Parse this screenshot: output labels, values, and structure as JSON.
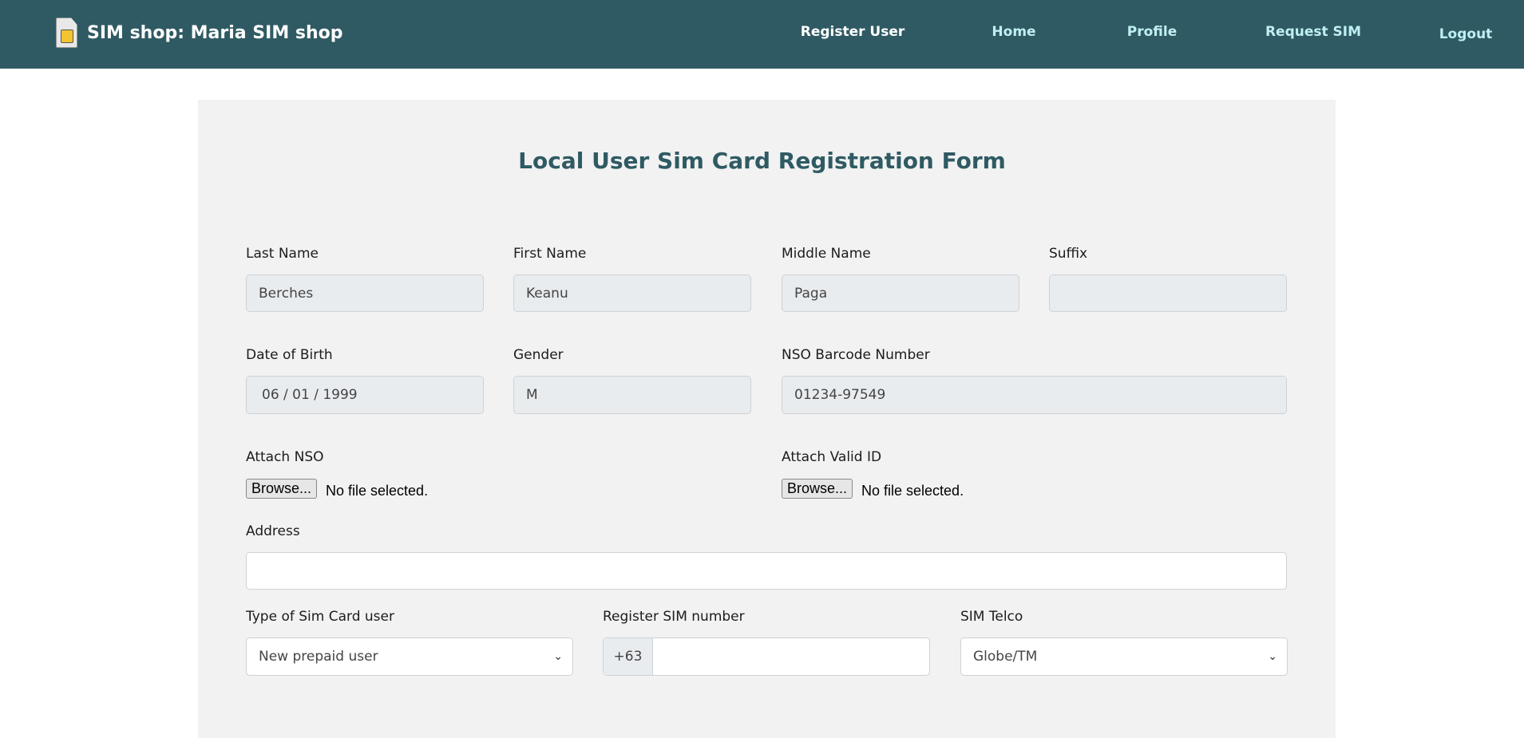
{
  "header": {
    "brand": "SIM shop: Maria SIM shop",
    "nav": [
      "Register User",
      "Home",
      "Profile",
      "Request SIM",
      "Logout"
    ]
  },
  "form": {
    "title": "Local User Sim Card Registration Form",
    "last_name": {
      "label": "Last Name",
      "value": "Berches"
    },
    "first_name": {
      "label": "First Name",
      "value": "Keanu"
    },
    "middle_name": {
      "label": "Middle Name",
      "value": "Paga"
    },
    "suffix": {
      "label": "Suffix",
      "value": ""
    },
    "dob": {
      "label": "Date of Birth",
      "value": "06 / 01 / 1999"
    },
    "gender": {
      "label": "Gender",
      "value": "M"
    },
    "nso": {
      "label": "NSO Barcode Number",
      "value": "01234-97549"
    },
    "attach_nso": {
      "label": "Attach NSO",
      "button": "Browse...",
      "status": "No file selected."
    },
    "attach_id": {
      "label": "Attach Valid ID",
      "button": "Browse...",
      "status": "No file selected."
    },
    "address": {
      "label": "Address",
      "value": ""
    },
    "sim_type": {
      "label": "Type of Sim Card user",
      "value": "New prepaid user"
    },
    "sim_number": {
      "label": "Register SIM number",
      "prefix": "+63",
      "value": ""
    },
    "telco": {
      "label": "SIM Telco",
      "value": "Globe/TM"
    }
  }
}
